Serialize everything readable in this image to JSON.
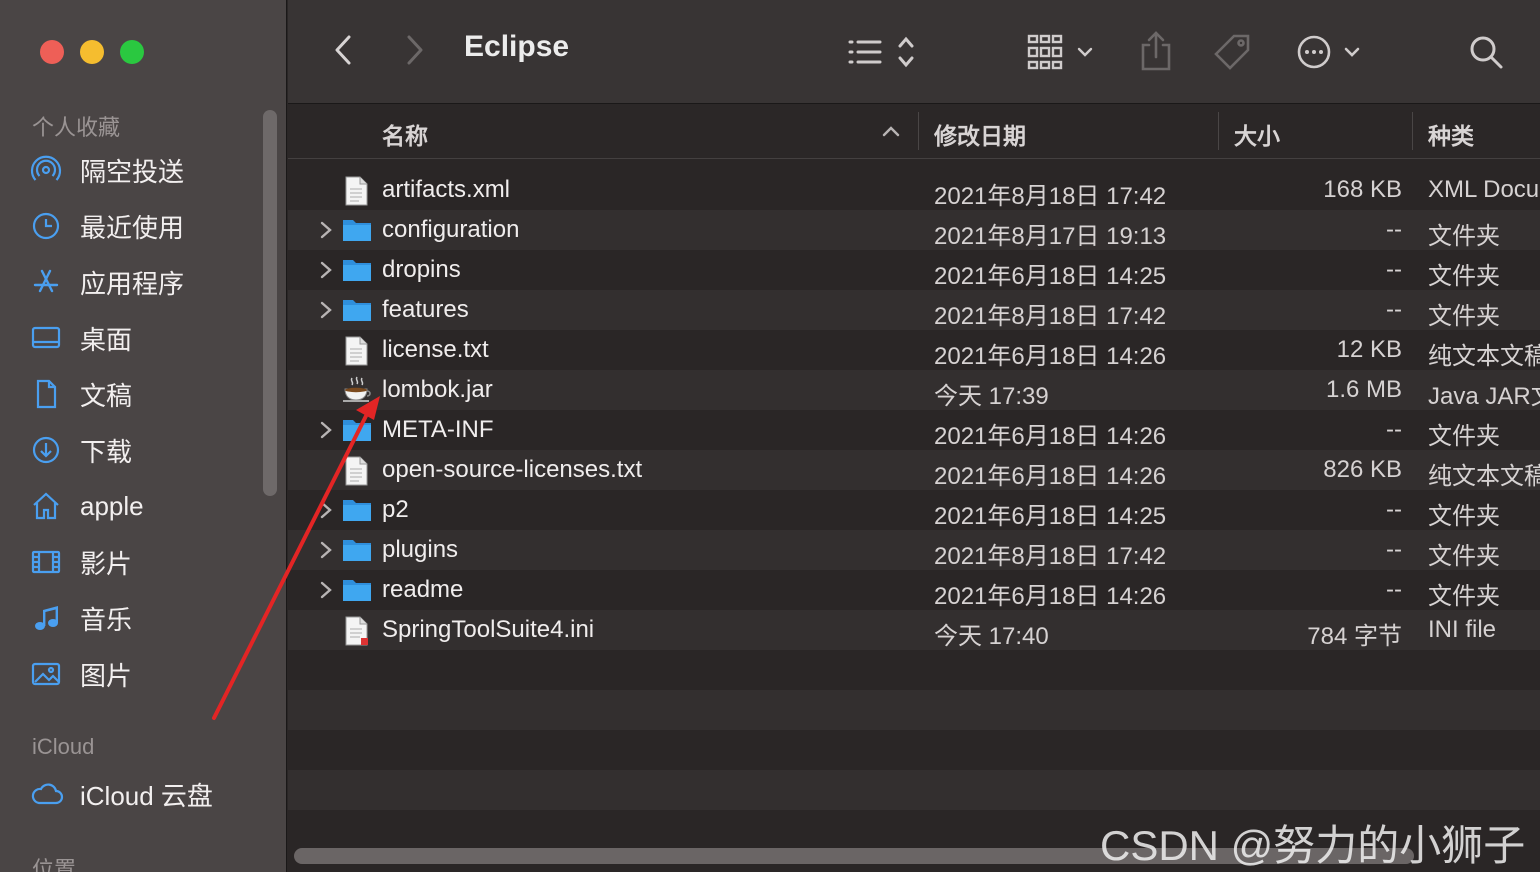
{
  "window": {
    "title": "Eclipse"
  },
  "sidebar": {
    "favorites_header": "个人收藏",
    "favorites": [
      {
        "label": "隔空投送",
        "icon": "airdrop-icon"
      },
      {
        "label": "最近使用",
        "icon": "clock-icon"
      },
      {
        "label": "应用程序",
        "icon": "applications-icon"
      },
      {
        "label": "桌面",
        "icon": "desktop-icon"
      },
      {
        "label": "文稿",
        "icon": "document-icon"
      },
      {
        "label": "下载",
        "icon": "download-icon"
      },
      {
        "label": "apple",
        "icon": "home-icon"
      },
      {
        "label": "影片",
        "icon": "film-icon"
      },
      {
        "label": "音乐",
        "icon": "music-icon"
      },
      {
        "label": "图片",
        "icon": "photo-icon"
      }
    ],
    "icloud_header": "iCloud",
    "icloud": [
      {
        "label": "iCloud 云盘",
        "icon": "cloud-icon"
      }
    ],
    "locations_header": "位置"
  },
  "columns": {
    "name": "名称",
    "date": "修改日期",
    "size": "大小",
    "kind": "种类"
  },
  "files": [
    {
      "name": "artifacts.xml",
      "date": "2021年8月18日 17:42",
      "size": "168 KB",
      "kind": "XML Docu",
      "type": "doc"
    },
    {
      "name": "configuration",
      "date": "2021年8月17日 19:13",
      "size": "--",
      "kind": "文件夹",
      "type": "folder"
    },
    {
      "name": "dropins",
      "date": "2021年6月18日 14:25",
      "size": "--",
      "kind": "文件夹",
      "type": "folder"
    },
    {
      "name": "features",
      "date": "2021年8月18日 17:42",
      "size": "--",
      "kind": "文件夹",
      "type": "folder"
    },
    {
      "name": "license.txt",
      "date": "2021年6月18日 14:26",
      "size": "12 KB",
      "kind": "纯文本文稿",
      "type": "doc"
    },
    {
      "name": "lombok.jar",
      "date": "今天 17:39",
      "size": "1.6 MB",
      "kind": "Java JAR文",
      "type": "jar"
    },
    {
      "name": "META-INF",
      "date": "2021年6月18日 14:26",
      "size": "--",
      "kind": "文件夹",
      "type": "folder"
    },
    {
      "name": "open-source-licenses.txt",
      "date": "2021年6月18日 14:26",
      "size": "826 KB",
      "kind": "纯文本文稿",
      "type": "doc"
    },
    {
      "name": "p2",
      "date": "2021年6月18日 14:25",
      "size": "--",
      "kind": "文件夹",
      "type": "folder"
    },
    {
      "name": "plugins",
      "date": "2021年8月18日 17:42",
      "size": "--",
      "kind": "文件夹",
      "type": "folder"
    },
    {
      "name": "readme",
      "date": "2021年6月18日 14:26",
      "size": "--",
      "kind": "文件夹",
      "type": "folder"
    },
    {
      "name": "SpringToolSuite4.ini",
      "date": "今天 17:40",
      "size": "784 字节",
      "kind": "INI file",
      "type": "ini"
    }
  ],
  "watermark": "CSDN @努力的小狮子",
  "colors": {
    "folder": "#3fa7f0",
    "accent": "#4a9ff0",
    "annotation_arrow": "#e32525"
  }
}
